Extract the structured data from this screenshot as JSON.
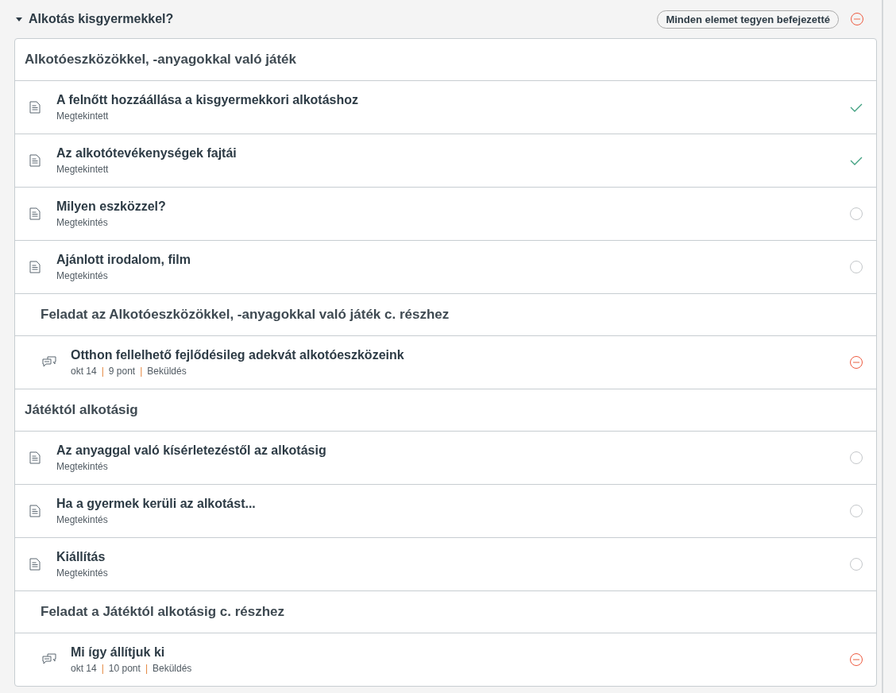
{
  "module": {
    "title": "Alkotás kisgyermekkel?",
    "expanded": true,
    "button": "Minden elemet tegyen befejezetté",
    "completed": false,
    "overdue": true
  },
  "separator": "|",
  "rows": [
    {
      "kind": "section",
      "title": "Alkotóeszközökkel, -anyagokkal való játék"
    },
    {
      "kind": "page",
      "title": "A felnőtt hozzáállása a kisgyermekkori alkotáshoz",
      "meta": [
        "Megtekintett"
      ],
      "completed": true,
      "overdue": false
    },
    {
      "kind": "page",
      "title": "Az alkotótevékenységek fajtái",
      "meta": [
        "Megtekintett"
      ],
      "completed": true,
      "overdue": false
    },
    {
      "kind": "page",
      "title": "Milyen eszközzel?",
      "meta": [
        "Megtekintés"
      ],
      "completed": false,
      "overdue": false
    },
    {
      "kind": "page",
      "title": "Ajánlott irodalom, film",
      "meta": [
        "Megtekintés"
      ],
      "completed": false,
      "overdue": false
    },
    {
      "kind": "subsection",
      "title": "Feladat az Alkotóeszközökkel, -anyagokkal való játék c. részhez"
    },
    {
      "kind": "assignment",
      "title": "Otthon fellelhető fejlődésileg adekvát alkotóeszközeink",
      "meta": [
        "okt 14",
        "9 pont",
        "Beküldés"
      ],
      "completed": false,
      "overdue": true
    },
    {
      "kind": "section",
      "title": "Játéktól alkotásig"
    },
    {
      "kind": "page",
      "title": "Az anyaggal való kísérletezéstől az alkotásig",
      "meta": [
        "Megtekintés"
      ],
      "completed": false,
      "overdue": false
    },
    {
      "kind": "page",
      "title": "Ha a gyermek kerüli az alkotást...",
      "meta": [
        "Megtekintés"
      ],
      "completed": false,
      "overdue": false
    },
    {
      "kind": "page",
      "title": "Kiállítás",
      "meta": [
        "Megtekintés"
      ],
      "completed": false,
      "overdue": false
    },
    {
      "kind": "subsection",
      "title": "Feladat a Játéktól alkotásig c. részhez"
    },
    {
      "kind": "assignment",
      "title": "Mi így állítjuk ki",
      "meta": [
        "okt 14",
        "10 pont",
        "Beküldés"
      ],
      "completed": false,
      "overdue": true
    }
  ]
}
